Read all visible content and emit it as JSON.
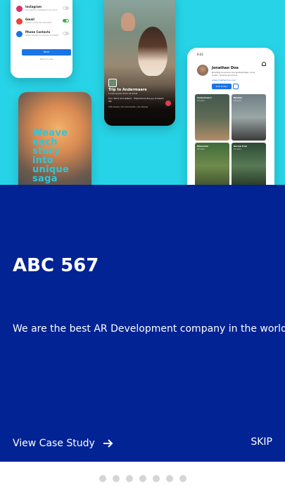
{
  "hero": {
    "connect_phone": {
      "accounts": [
        {
          "name": "Instagram",
          "subtitle": "Connected Instagram account",
          "color": "#d6336c",
          "enabled": false
        },
        {
          "name": "Gmail",
          "subtitle": "Gmail contacts imported",
          "color": "#ea4335",
          "enabled": true
        },
        {
          "name": "Phone Contacts",
          "subtitle": "Allow access to phone contacts",
          "color": "#1a73e8",
          "enabled": false
        }
      ],
      "next_label": "Next",
      "skip_label": "Skip for now"
    },
    "trip_phone": {
      "title": "Trip to Andermaare",
      "subtitle": "Lorem ipsum dolor sit amet",
      "description": "Sun, Sand and waters... Experience the joy of beach life",
      "meta": "156 views | 24 comments | 10 shares"
    },
    "reading_phone": {
      "quote_lines": [
        "Weave",
        "each",
        "story",
        "into",
        "unique",
        "saga"
      ]
    },
    "profile_phone": {
      "status_time": "9:41",
      "name": "Jonathan Doe",
      "bio": "Budding musician and globetrotter. Love music, movies and food.",
      "link": "www.jonathandoe.com",
      "edit_label": "Edit Profile",
      "tiles": [
        {
          "title": "Andermaare",
          "sub": "24 pics"
        },
        {
          "title": "Bhutan",
          "sub": "18 pics"
        },
        {
          "title": "Himachal",
          "sub": "32 pics"
        },
        {
          "title": "Kerala trek",
          "sub": "12 pics"
        }
      ]
    }
  },
  "panel": {
    "title": "ABC 567",
    "tagline": "We are the best AR Development company in the world",
    "case_study_label": "View Case Study",
    "skip_label": "SKIP"
  },
  "pagination": {
    "total": 7,
    "active_index": 0
  },
  "colors": {
    "hero_bg": "#27d3e6",
    "panel_bg": "#022394",
    "dot": "#d5d5d5"
  }
}
